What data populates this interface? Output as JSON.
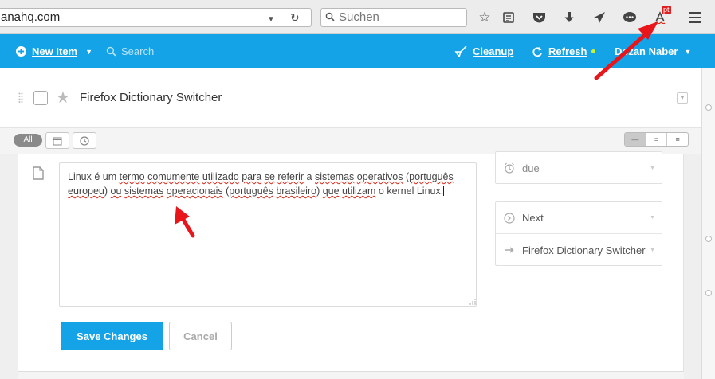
{
  "browser": {
    "url_text": "anahq.com",
    "search_placeholder": "Suchen",
    "dictionary_badge": "pt",
    "icons": [
      "bookmark-star-icon",
      "reading-list-icon",
      "pocket-icon",
      "download-icon",
      "send-icon",
      "chat-icon",
      "dictionary-icon",
      "menu-icon"
    ]
  },
  "app": {
    "new_item_label": "New Item",
    "search_label": "Search",
    "cleanup_label": "Cleanup",
    "refresh_label": "Refresh",
    "user_label": "Dozan Naber",
    "brand_color": "#14a3e6"
  },
  "task": {
    "title": "Firefox Dictionary Switcher"
  },
  "filters": {
    "all_label": "All",
    "calendar_label": "31"
  },
  "note": {
    "text_parts": [
      {
        "t": "Linux é um ",
        "sp": false
      },
      {
        "t": "termo",
        "sp": true
      },
      {
        "t": " ",
        "sp": false
      },
      {
        "t": "comumente",
        "sp": true
      },
      {
        "t": " ",
        "sp": false
      },
      {
        "t": "utilizado",
        "sp": true
      },
      {
        "t": " ",
        "sp": false
      },
      {
        "t": "para",
        "sp": true
      },
      {
        "t": " ",
        "sp": false
      },
      {
        "t": "se",
        "sp": true
      },
      {
        "t": " ",
        "sp": false
      },
      {
        "t": "referir",
        "sp": true
      },
      {
        "t": " a ",
        "sp": false
      },
      {
        "t": "sistemas",
        "sp": true
      },
      {
        "t": " ",
        "sp": false
      },
      {
        "t": "operativos",
        "sp": true
      },
      {
        "t": " (",
        "sp": false
      },
      {
        "t": "português",
        "sp": true
      },
      {
        "t": " ",
        "sp": false
      },
      {
        "t": "europeu",
        "sp": true
      },
      {
        "t": ") ",
        "sp": false
      },
      {
        "t": "ou",
        "sp": true
      },
      {
        "t": " ",
        "sp": false
      },
      {
        "t": "sistemas",
        "sp": true
      },
      {
        "t": " ",
        "sp": false
      },
      {
        "t": "operacionais",
        "sp": true
      },
      {
        "t": " (",
        "sp": false
      },
      {
        "t": "português",
        "sp": true
      },
      {
        "t": " ",
        "sp": false
      },
      {
        "t": "brasileiro",
        "sp": true
      },
      {
        "t": ") ",
        "sp": false
      },
      {
        "t": "que",
        "sp": true
      },
      {
        "t": " ",
        "sp": false
      },
      {
        "t": "utilizam",
        "sp": true
      },
      {
        "t": " o kernel Linux.",
        "sp": false
      }
    ]
  },
  "buttons": {
    "save_label": "Save Changes",
    "cancel_label": "Cancel"
  },
  "side": {
    "due_label": "due",
    "next_label": "Next",
    "parent_label": "Firefox Dictionary Switcher"
  }
}
